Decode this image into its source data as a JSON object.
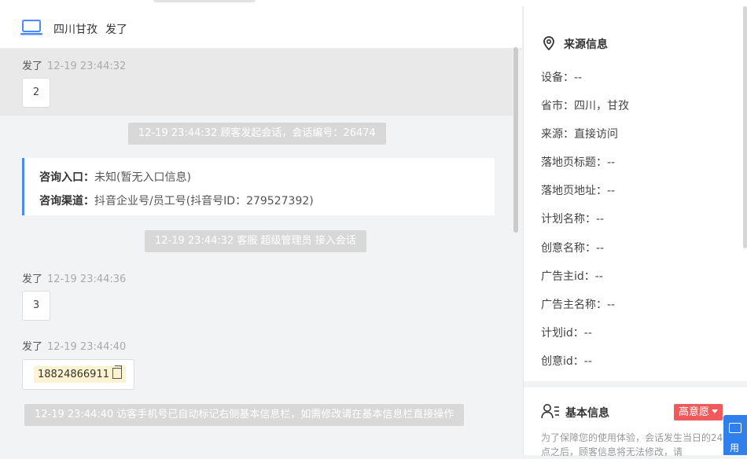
{
  "header": {
    "location": "四川甘孜",
    "name": "发了"
  },
  "messages": [
    {
      "sender": "发了",
      "time": "12-19 23:44:32",
      "text": "2"
    },
    {
      "sender": "发了",
      "time": "12-19 23:44:36",
      "text": "3"
    },
    {
      "sender": "发了",
      "time": "12-19 23:44:40",
      "text": "18824866911"
    }
  ],
  "system": {
    "start": "12-19 23:44:32 顾客发起会话，会话编号：26474",
    "join": "12-19 23:44:32 客服 超级管理员 接入会话",
    "phone_notice": "12-19 23:44:40 访客手机号已自动标记右侧基本信息栏，如需修改请在基本信息栏直接操作"
  },
  "consult": {
    "entry_label": "咨询入口：",
    "entry_value": "未知(暂无入口信息)",
    "channel_label": "咨询渠道：",
    "channel_value": "抖音企业号/员工号(抖音号ID：279527392)"
  },
  "info": {
    "title": "来源信息",
    "fields": [
      "设备：--",
      "省市：四川，甘孜",
      "来源：直接访问",
      "落地页标题：--",
      "落地页地址：--",
      "计划名称：--",
      "创意名称：--",
      "广告主id：--",
      "广告主名称：--",
      "计划id：--",
      "创意id：--"
    ]
  },
  "basic": {
    "title": "基本信息",
    "badge": "高意愿",
    "notice": "为了保障您的使用体验，会话发生当日的24点之后，顾客信息将无法修改，请"
  },
  "float_button": {
    "label": "用"
  },
  "colors": {
    "accent": "#4a8cf7",
    "badge": "#f05a5a",
    "highlight": "#fdf3cf",
    "float": "#2f80ed"
  }
}
